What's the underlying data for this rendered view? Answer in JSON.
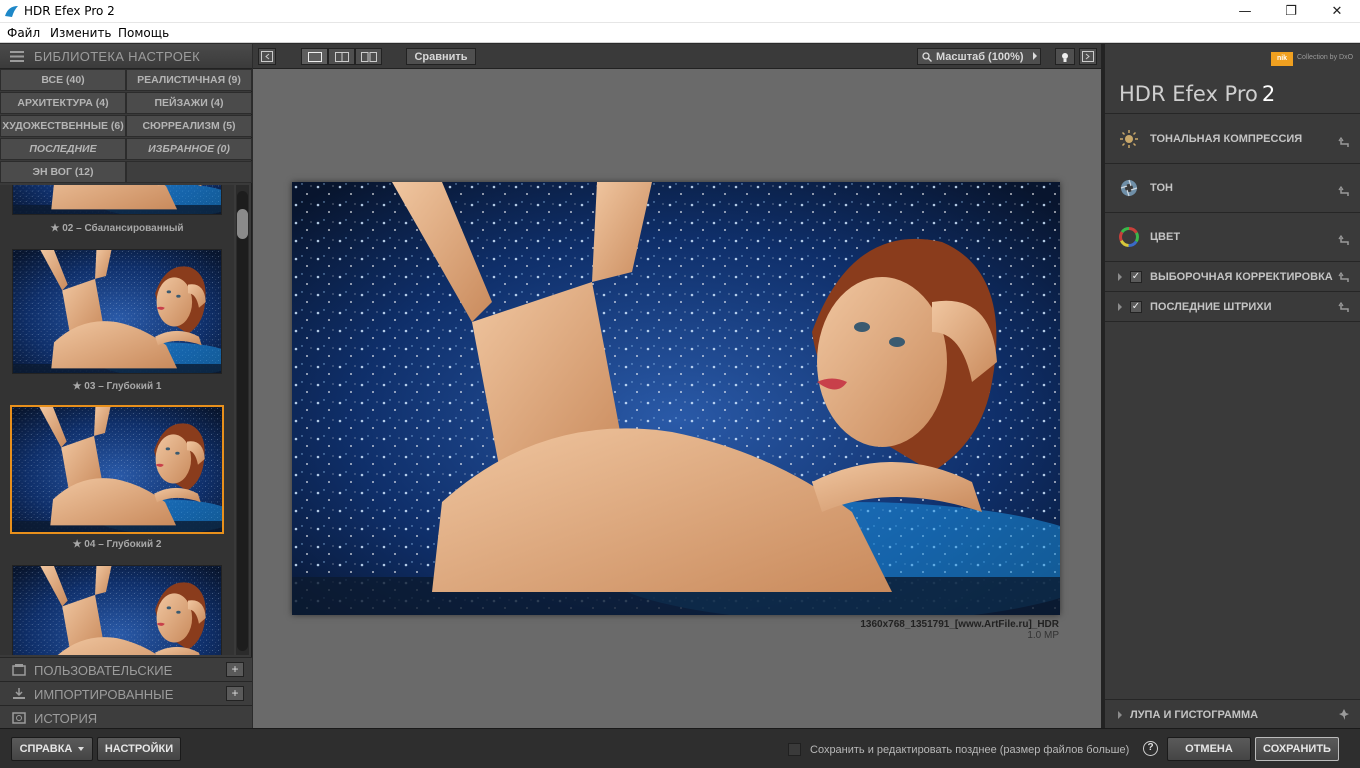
{
  "window": {
    "title": "HDR Efex Pro 2",
    "minimize": "—",
    "maximize": "❐",
    "close": "✕"
  },
  "menu": [
    "Файл",
    "Изменить",
    "Помощь"
  ],
  "library": {
    "title": "БИБЛИОТЕКА НАСТРОЕК",
    "categories": [
      "ВСЕ (40)",
      "РЕАЛИСТИЧНАЯ (9)",
      "АРХИТЕКТУРА (4)",
      "ПЕЙЗАЖИ (4)",
      "ХУДОЖЕСТВЕННЫЕ (6)",
      "СЮРРЕАЛИЗМ (5)",
      "ПОСЛЕДНИЕ",
      "ИЗБРАННОЕ (0)",
      "ЭН ВОГ (12)"
    ],
    "presets": [
      {
        "caption": "★ 02 – Сбалансированный"
      },
      {
        "caption": "★ 03 – Глубокий 1"
      },
      {
        "caption": "★ 04 – Глубокий 2",
        "selected": true
      }
    ],
    "sections": [
      "ПОЛЬЗОВАТЕЛЬСКИЕ",
      "ИМПОРТИРОВАННЫЕ",
      "ИСТОРИЯ"
    ]
  },
  "toolbar": {
    "compare": "Сравнить",
    "zoom": "Масштаб (100%)"
  },
  "image": {
    "filename": "1360x768_1351791_[www.ArtFile.ru]_HDR",
    "size": "1.0 MP"
  },
  "right_panel": {
    "logo_text": "nik",
    "logo_sub": "Collection by DxO",
    "product": "HDR Efex Pro",
    "version": "2",
    "sections": [
      {
        "label": "ТОНАЛЬНАЯ КОМПРЕССИЯ"
      },
      {
        "label": "ТОН"
      },
      {
        "label": "ЦВЕТ"
      },
      {
        "label": "ВЫБОРОЧНАЯ КОРРЕКТИРОВКА"
      },
      {
        "label": "ПОСЛЕДНИЕ ШТРИХИ"
      }
    ],
    "loupe": "ЛУПА И ГИСТОГРАММА"
  },
  "footer": {
    "help": "СПРАВКА",
    "settings": "НАСТРОЙКИ",
    "save_later": "Сохранить и редактировать позднее (размер файлов больше)",
    "cancel": "ОТМЕНА",
    "save": "СОХРАНИТЬ"
  },
  "colors": {
    "accent": "#e8901c",
    "canvas": "#6a6a6a",
    "panel": "#3a3a3a"
  }
}
